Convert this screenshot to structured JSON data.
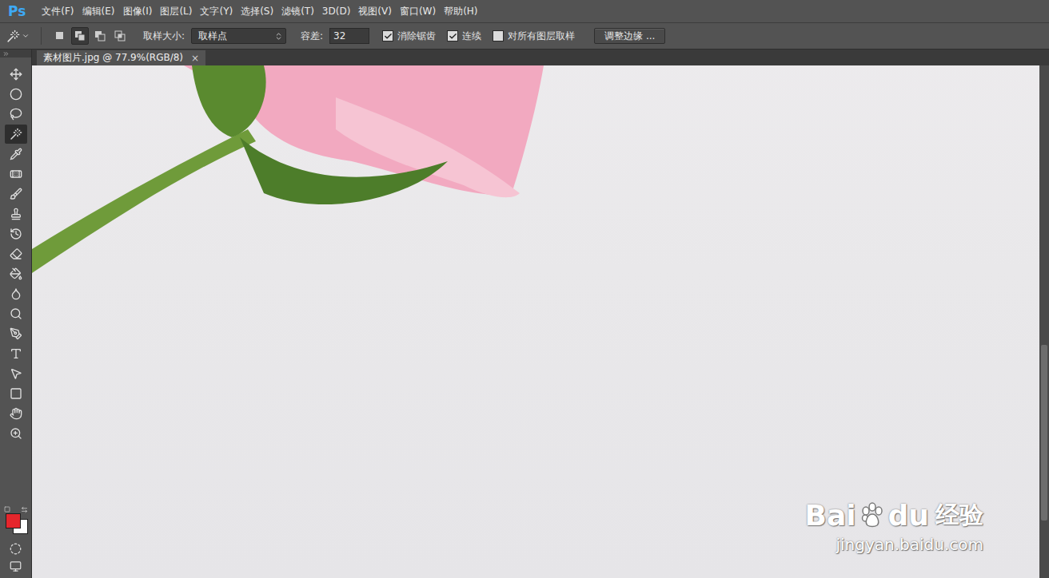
{
  "app": {
    "logo": "Ps"
  },
  "menu": [
    "文件(F)",
    "编辑(E)",
    "图像(I)",
    "图层(L)",
    "文字(Y)",
    "选择(S)",
    "滤镜(T)",
    "3D(D)",
    "视图(V)",
    "窗口(W)",
    "帮助(H)"
  ],
  "options": {
    "mode_buttons": [
      {
        "selected": false
      },
      {
        "selected": true
      },
      {
        "selected": false
      },
      {
        "selected": false
      }
    ],
    "sample_size": {
      "label": "取样大小:",
      "value": "取样点"
    },
    "tolerance": {
      "label": "容差:",
      "value": "32"
    },
    "checkboxes": [
      {
        "label": "消除锯齿",
        "checked": true
      },
      {
        "label": "连续",
        "checked": true
      },
      {
        "label": "对所有图层取样",
        "checked": false
      }
    ],
    "buttons": [
      "调整边缘 ..."
    ]
  },
  "document_tab": {
    "title": "素材图片.jpg @ 77.9%(RGB/8)",
    "close": "×",
    "selected": true
  },
  "tools": [
    {
      "selected": false
    },
    {
      "selected": false
    },
    {
      "selected": false
    },
    {
      "selected": true
    },
    {
      "selected": false
    },
    {
      "selected": false
    },
    {
      "selected": false
    },
    {
      "selected": false
    },
    {
      "selected": false
    },
    {
      "selected": false
    },
    {
      "selected": false
    },
    {
      "selected": false
    },
    {
      "selected": false
    },
    {
      "selected": false
    },
    {
      "selected": false
    },
    {
      "selected": false
    },
    {
      "selected": false
    },
    {
      "selected": false
    },
    {
      "selected": false
    }
  ],
  "colors": {
    "foreground": "#e5262c",
    "background": "#ffffff"
  },
  "watermark": {
    "brand_left": "Bai",
    "brand_right": "du",
    "label": "经验",
    "url": "jingyan.baidu.com"
  }
}
